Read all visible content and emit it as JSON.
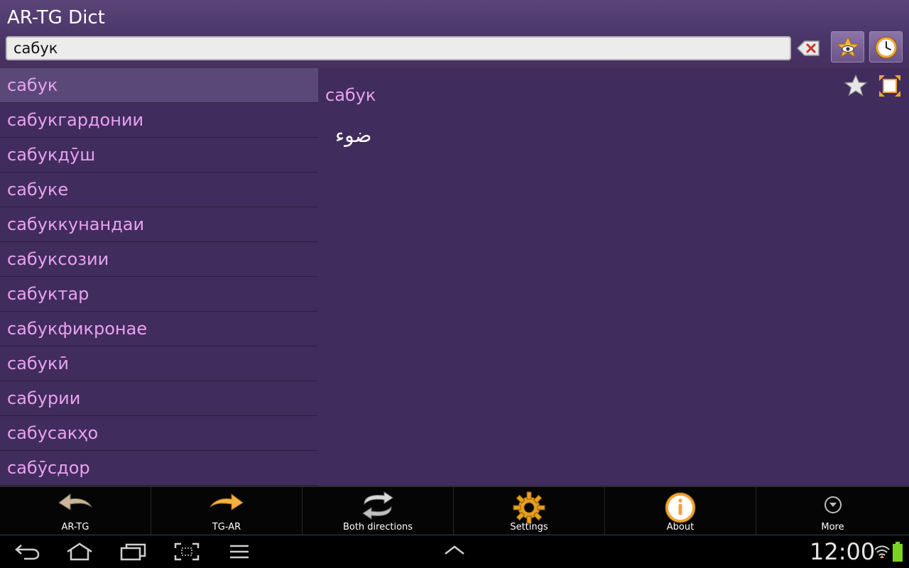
{
  "app": {
    "title": "AR-TG Dict"
  },
  "search": {
    "value": "сабук"
  },
  "word_list": [
    {
      "label": "сабук",
      "selected": true
    },
    {
      "label": "сабукгардонии"
    },
    {
      "label": "сабукдӯш"
    },
    {
      "label": "сабуке"
    },
    {
      "label": "сабуккунандаи"
    },
    {
      "label": "сабуксозии"
    },
    {
      "label": "сабуктар"
    },
    {
      "label": "сабукфикронае"
    },
    {
      "label": "сабукӣ"
    },
    {
      "label": "сабурии"
    },
    {
      "label": "сабусакҳо"
    },
    {
      "label": "сабӯсдор"
    }
  ],
  "definition": {
    "headword": "сабук",
    "translation": "ضوء"
  },
  "actions": [
    {
      "label": "AR-TG",
      "icon": "arrow-left-icon"
    },
    {
      "label": "TG-AR",
      "icon": "arrow-right-icon"
    },
    {
      "label": "Both directions",
      "icon": "swap-icon"
    },
    {
      "label": "Settings",
      "icon": "gear-icon"
    },
    {
      "label": "About",
      "icon": "info-icon"
    },
    {
      "label": "More",
      "icon": "chevron-down-icon"
    }
  ],
  "status": {
    "time": "12:00"
  },
  "colors": {
    "background": "#412c5e",
    "selected_row": "#5a4878",
    "word_text": "#e8a2ec",
    "accent_orange": "#f2a33a"
  }
}
